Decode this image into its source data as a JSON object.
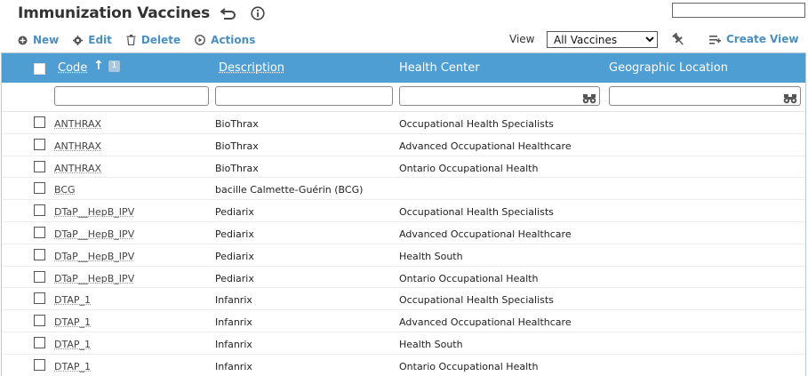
{
  "page": {
    "title": "Immunization Vaccines",
    "search_value": ""
  },
  "toolbar": {
    "new_label": "New",
    "edit_label": "Edit",
    "delete_label": "Delete",
    "actions_label": "Actions",
    "view_label": "View",
    "view_selected": "All Vaccines",
    "create_view_label": "Create View"
  },
  "colors": {
    "accent": "#4a8fc0",
    "header_bg": "#4f9ed3"
  },
  "grid": {
    "columns": {
      "code": "Code",
      "description": "Description",
      "health_center": "Health Center",
      "geo_location": "Geographic Location"
    },
    "sort_badge": "1",
    "rows": [
      {
        "code": "ANTHRAX",
        "description": "BioThrax",
        "health_center": "Occupational Health Specialists",
        "geo": ""
      },
      {
        "code": "ANTHRAX",
        "description": "BioThrax",
        "health_center": "Advanced Occupational Healthcare",
        "geo": ""
      },
      {
        "code": "ANTHRAX",
        "description": "BioThrax",
        "health_center": "Ontario Occupational Health",
        "geo": ""
      },
      {
        "code": "BCG",
        "description": "bacille Calmette-Guérin (BCG)",
        "health_center": "",
        "geo": ""
      },
      {
        "code": "DTaP__HepB_IPV",
        "description": "Pediarix",
        "health_center": "Occupational Health Specialists",
        "geo": ""
      },
      {
        "code": "DTaP__HepB_IPV",
        "description": "Pediarix",
        "health_center": "Advanced Occupational Healthcare",
        "geo": ""
      },
      {
        "code": "DTaP__HepB_IPV",
        "description": "Pediarix",
        "health_center": "Health South",
        "geo": ""
      },
      {
        "code": "DTaP__HepB_IPV",
        "description": "Pediarix",
        "health_center": "Ontario Occupational Health",
        "geo": ""
      },
      {
        "code": "DTAP_1",
        "description": "Infanrix",
        "health_center": "Occupational Health Specialists",
        "geo": ""
      },
      {
        "code": "DTAP_1",
        "description": "Infanrix",
        "health_center": "Advanced Occupational Healthcare",
        "geo": ""
      },
      {
        "code": "DTAP_1",
        "description": "Infanrix",
        "health_center": "Health South",
        "geo": ""
      },
      {
        "code": "DTAP_1",
        "description": "Infanrix",
        "health_center": "Ontario Occupational Health",
        "geo": ""
      }
    ]
  }
}
